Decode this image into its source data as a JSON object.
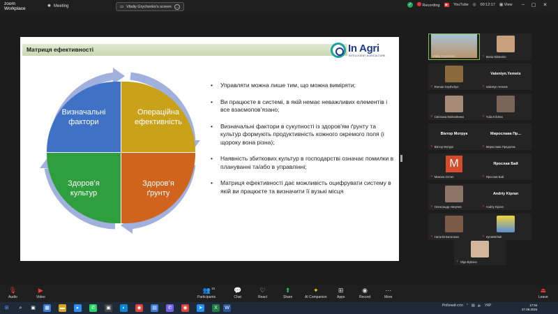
{
  "app": {
    "logo_line1": "zoom",
    "logo_line2": "Workplace",
    "meeting_label": "Meeting"
  },
  "screen_tab": {
    "label": "Vitaliy Grychenko's screen"
  },
  "status": {
    "recording": "Recording",
    "youtube": "YouTube",
    "timer": "00:12:17",
    "view": "View"
  },
  "slide": {
    "title": "Матриця ефективності",
    "logo_text": "In Agri",
    "logo_sub": "INTELLIGENT AGRICULTURE",
    "quadrants": [
      {
        "line1": "Визначальні",
        "line2": "фактори",
        "color": "#3f71c6"
      },
      {
        "line1": "Операційна",
        "line2": "ефективність",
        "color": "#c9a21a"
      },
      {
        "line1": "Здоров’я",
        "line2": "культур",
        "color": "#2e9e3e"
      },
      {
        "line1": "Здоров’я",
        "line2": "ґрунту",
        "color": "#d0641c"
      }
    ],
    "bullets": [
      "Управляти можна лише тим, що можна виміряти;",
      "Ви працюєте в системі, в якій немає неважливих елементів і все взаємопов’язано;",
      "Визначальні фактори в сукупності із здоров'ям ґрунту та культур формують продуктивність кожного окремого поля (і щороку вона різна);",
      "Наявність збиткових культур в господарстві означає помилки в плануванні та/або в управлінні;",
      " Матриця ефективності дає можливість оцифрувати систему в якій ви працюєте та визначити її вузькі місця"
    ]
  },
  "participants": [
    {
      "name": "Vitaliy Grychenko",
      "photo": "#b9946b"
    },
    {
      "name": "Maria Nikitenko",
      "photo": "#c9a07c"
    },
    {
      "name": "Roman Gryshchyn",
      "photo": "#8a6a3a"
    },
    {
      "name": "Valentyn.Yemets",
      "big": "Valentyn.Yemets"
    },
    {
      "name": "Світлана Мойсейенко",
      "photo": "#a88a78"
    },
    {
      "name": "Yulia Kilchna",
      "photo": "#7a6658"
    },
    {
      "name": "Віктор Мотрук",
      "big": "Віктор Мотрук"
    },
    {
      "name": "Мирослава Предоляк",
      "big": "Мирослава Пр..."
    },
    {
      "name": "Микола Остап",
      "letter": "M"
    },
    {
      "name": "Ярослав Бай",
      "big": "Ярослав Бай"
    },
    {
      "name": "Олександр Аверчев",
      "photo": "#8c7564"
    },
    {
      "name": "Andriy Kipran",
      "big": "Andriy Kipran"
    },
    {
      "name": "Наталія Батилюко",
      "photo": "#7b5a48"
    },
    {
      "name": "IrynaMichak",
      "photo": "#5b8fd6"
    },
    {
      "name": "Olga Bykova",
      "photo": "#d3b79c"
    }
  ],
  "toolbar": {
    "audio": "Audio",
    "video": "Video",
    "participants": "Participants",
    "participants_count": "15",
    "chat": "Chat",
    "react": "React",
    "share": "Share",
    "ai": "AI Companion",
    "apps": "Apps",
    "record": "Record",
    "more": "More",
    "leave": "Leave"
  },
  "taskbar": {
    "lang": "УКР",
    "keyboard": "Робочий стіл",
    "time": "17:04",
    "date": "27.09.2024"
  }
}
